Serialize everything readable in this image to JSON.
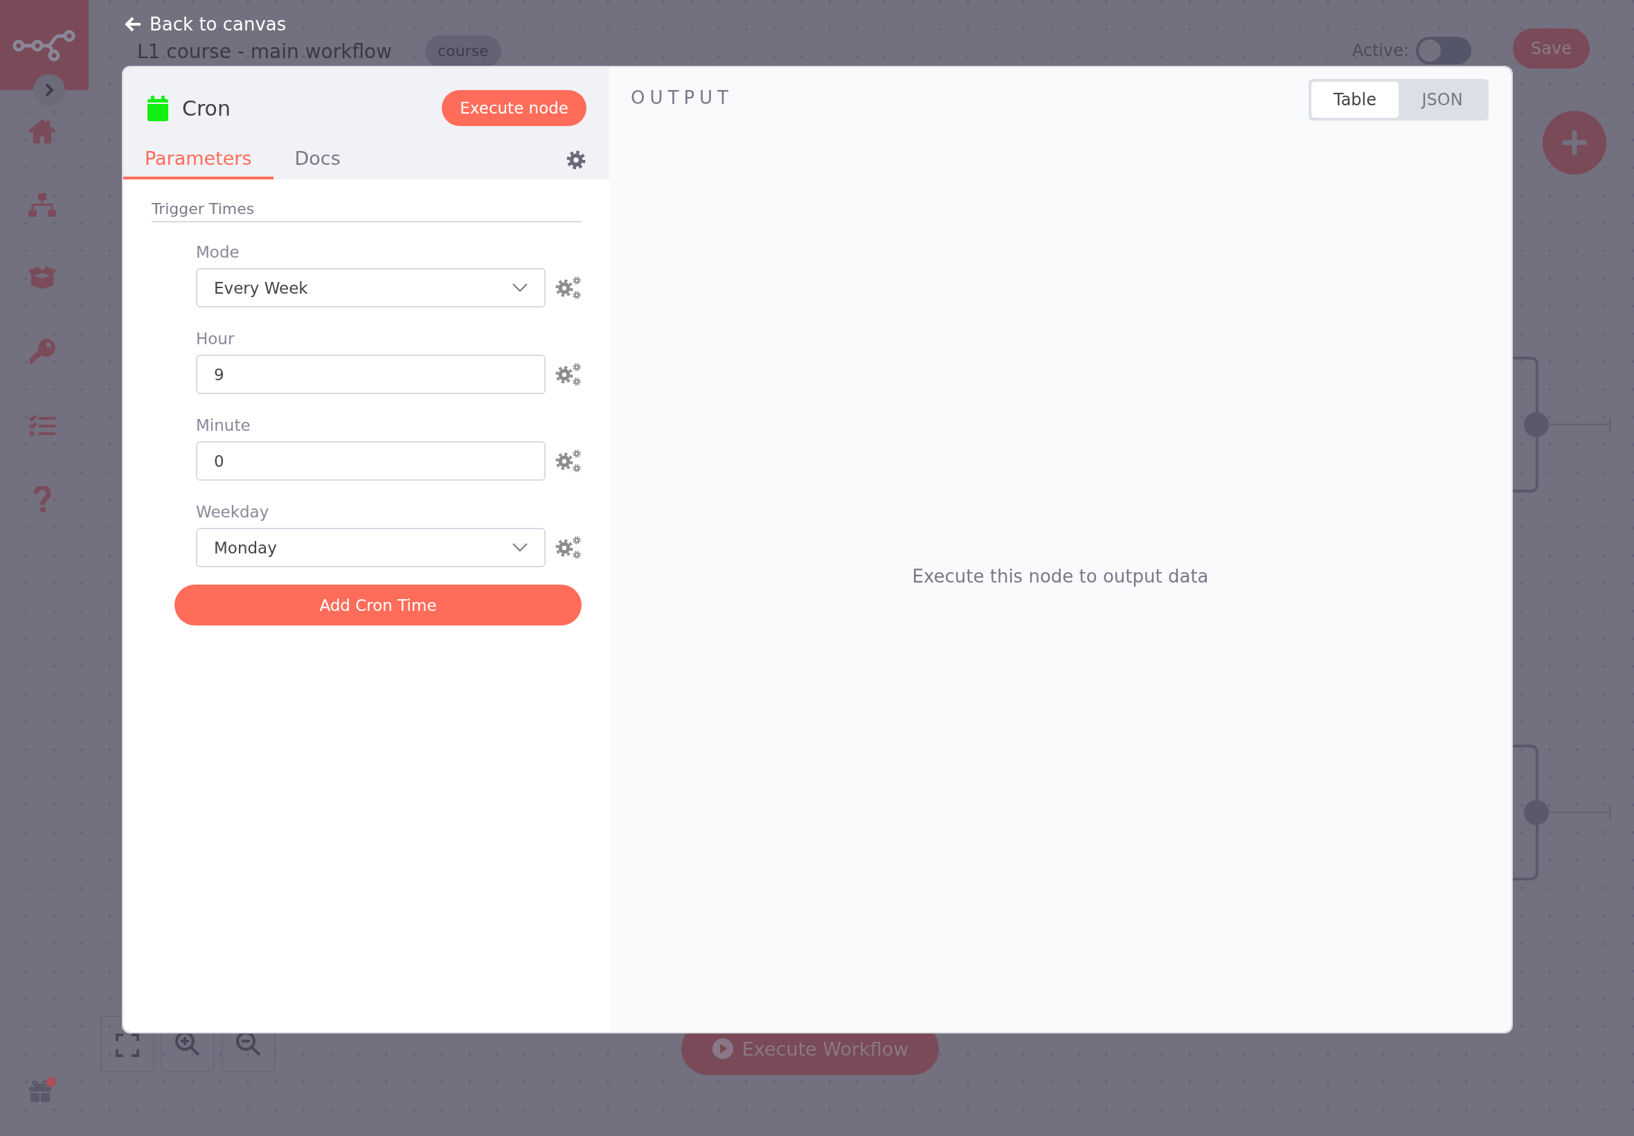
{
  "header": {
    "back_link": "Back to canvas",
    "workflow_name": "L1 course - main workflow",
    "tags": [
      "course"
    ],
    "active": {
      "label": "Active:",
      "on": false
    },
    "save_button": "Save"
  },
  "canvas": {
    "execute_workflow_button": "Execute Workflow"
  },
  "node_panel": {
    "title": "Cron",
    "execute_button": "Execute node",
    "tabs": [
      {
        "label": "Parameters",
        "selected": true
      },
      {
        "label": "Docs",
        "selected": false
      }
    ],
    "section": "Trigger Times",
    "fields": [
      {
        "kind": "select",
        "label": "Mode",
        "value": "Every Week"
      },
      {
        "kind": "input",
        "label": "Hour",
        "value": "9"
      },
      {
        "kind": "input",
        "label": "Minute",
        "value": "0"
      },
      {
        "kind": "select",
        "label": "Weekday",
        "value": "Monday"
      }
    ],
    "add_button": "Add Cron Time"
  },
  "output": {
    "title": "OUTPUT",
    "view_options": [
      {
        "label": "Table",
        "selected": true
      },
      {
        "label": "JSON",
        "selected": false
      }
    ],
    "empty_message": "Execute this node to output data"
  }
}
